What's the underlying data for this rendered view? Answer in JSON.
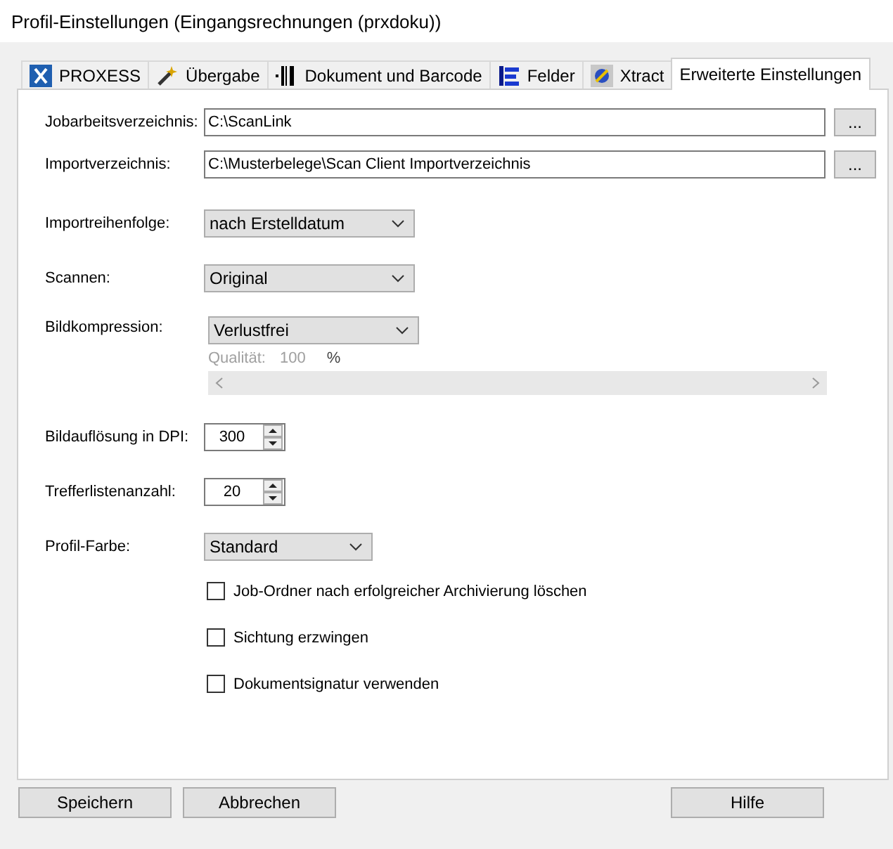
{
  "window": {
    "title": "Profil-Einstellungen (Eingangsrechnungen (prxdoku))"
  },
  "tabs": [
    {
      "label": "PROXESS",
      "kind": "proxess",
      "selected": false
    },
    {
      "label": "Übergabe",
      "kind": "wand",
      "selected": false
    },
    {
      "label": "Dokument und Barcode",
      "kind": "barcode",
      "selected": false
    },
    {
      "label": "Felder",
      "kind": "fields",
      "selected": false
    },
    {
      "label": "Xtract",
      "kind": "xtract",
      "selected": false
    },
    {
      "label": "Erweiterte Einstellungen",
      "kind": "none",
      "selected": true
    }
  ],
  "settings": [
    {
      "kind": "path",
      "label": "Jobarbeitsverzeichnis:",
      "value": "C:\\ScanLink",
      "button": "..."
    },
    {
      "kind": "path",
      "label": "Importverzeichnis:",
      "value": "C:\\Musterbelege\\Scan Client Importverzeichnis",
      "button": "..."
    },
    {
      "kind": "select",
      "label": "Importreihenfolge:",
      "value": "nach Erstelldatum"
    },
    {
      "kind": "select",
      "label": "Scannen:",
      "value": "Original"
    },
    {
      "kind": "compression",
      "label": "Bildkompression:",
      "value": "Verlustfrei",
      "quality_label": "Qualität:",
      "quality_value": "100",
      "quality_unit": "%",
      "quality_disabled": true
    },
    {
      "kind": "spin",
      "label": "Bildauflösung in DPI:",
      "value": "300"
    },
    {
      "kind": "spin",
      "label": "Trefferlistenanzahl:",
      "value": "20"
    },
    {
      "kind": "select_small",
      "label": "Profil-Farbe:",
      "value": "Standard"
    }
  ],
  "checkboxes": [
    {
      "label": "Job-Ordner nach erfolgreicher Archivierung löschen",
      "checked": false
    },
    {
      "label": "Sichtung erzwingen",
      "checked": false
    },
    {
      "label": "Dokumentsignatur verwenden",
      "checked": false
    }
  ],
  "buttons": [
    {
      "label": "Speichern",
      "kind": "left"
    },
    {
      "label": "Abbrechen",
      "kind": "left"
    },
    {
      "label": "Hilfe",
      "kind": "right"
    }
  ]
}
